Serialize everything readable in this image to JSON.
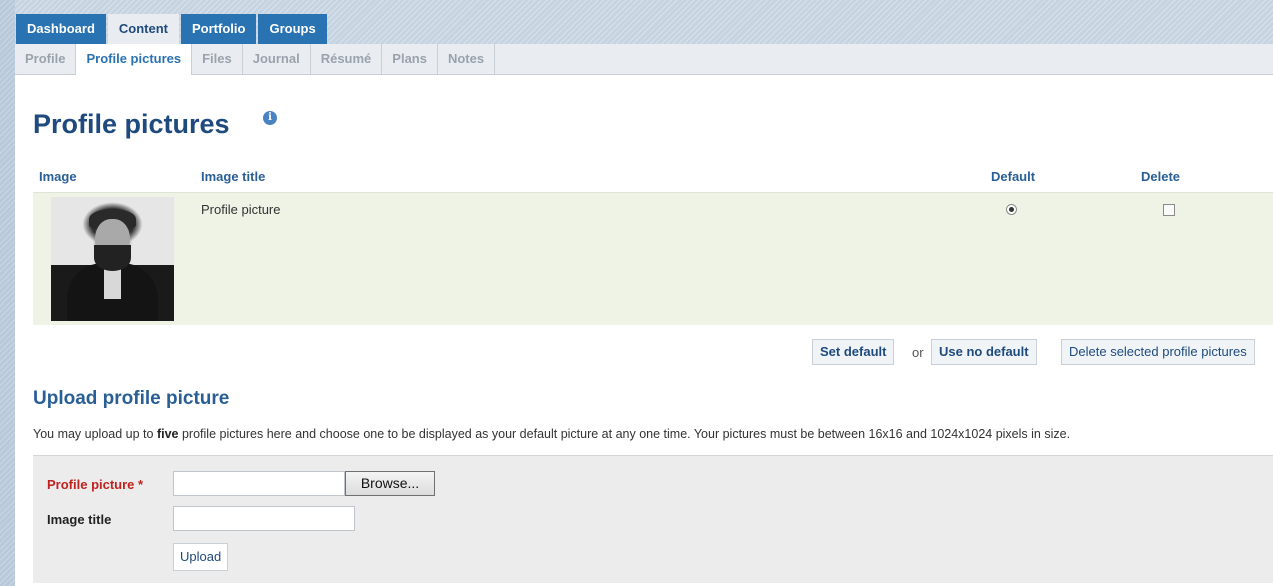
{
  "main_tabs": [
    {
      "label": "Dashboard",
      "active": false
    },
    {
      "label": "Content",
      "active": true
    },
    {
      "label": "Portfolio",
      "active": false
    },
    {
      "label": "Groups",
      "active": false
    }
  ],
  "sub_tabs": [
    {
      "label": "Profile",
      "active": false
    },
    {
      "label": "Profile pictures",
      "active": true
    },
    {
      "label": "Files",
      "active": false
    },
    {
      "label": "Journal",
      "active": false
    },
    {
      "label": "Résumé",
      "active": false
    },
    {
      "label": "Plans",
      "active": false
    },
    {
      "label": "Notes",
      "active": false
    }
  ],
  "page": {
    "title": "Profile pictures",
    "help_icon": "info-icon"
  },
  "table": {
    "headers": {
      "image": "Image",
      "title": "Image title",
      "default": "Default",
      "delete": "Delete"
    },
    "rows": [
      {
        "image_title": "Profile picture",
        "default_selected": true,
        "delete_checked": false
      }
    ]
  },
  "actions": {
    "set_default": "Set default",
    "or": "or",
    "use_no_default": "Use no default",
    "delete_selected": "Delete selected profile pictures"
  },
  "upload": {
    "title": "Upload profile picture",
    "desc_before": "You may upload up to ",
    "desc_bold": "five",
    "desc_after": " profile pictures here and choose one to be displayed as your default picture at any one time. Your pictures must be between 16x16 and 1024x1024 pixels in size.",
    "profile_picture_label": "Profile picture",
    "required_mark": "*",
    "browse_label": "Browse...",
    "image_title_label": "Image title",
    "upload_button": "Upload"
  },
  "colors": {
    "tab_blue": "#2a73b3",
    "title_blue": "#1f4a7e",
    "row_green": "#eef3e6",
    "required_red": "#c0231f"
  }
}
